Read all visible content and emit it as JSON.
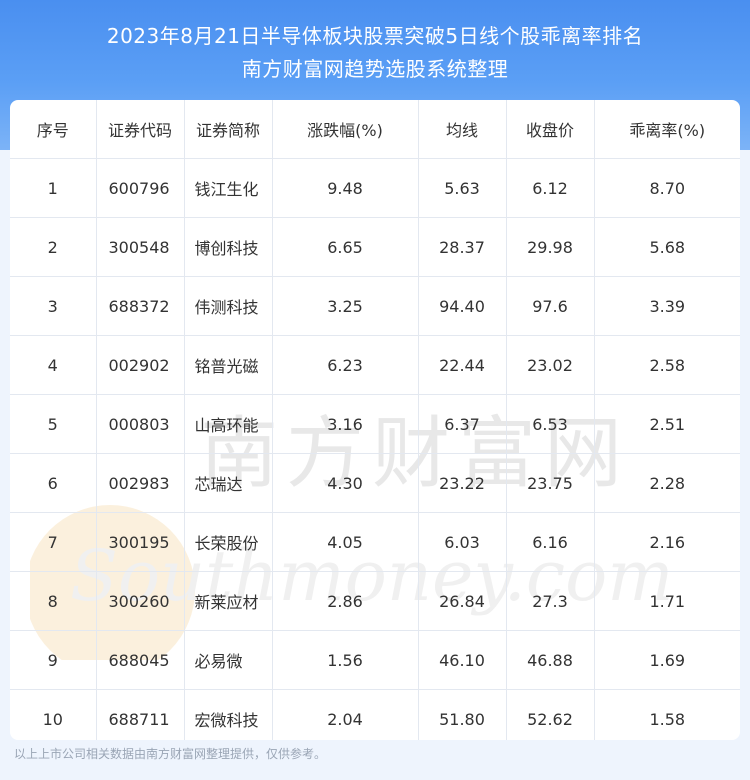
{
  "title": {
    "line1": "2023年8月21日半导体板块股票突破5日线个股乖离率排名",
    "line2": "南方财富网趋势选股系统整理"
  },
  "table": {
    "headers": [
      "序号",
      "证券代码",
      "证券简称",
      "涨跌幅(%)",
      "均线",
      "收盘价",
      "乖离率(%)"
    ],
    "rows": [
      [
        "1",
        "600796",
        "钱江生化",
        "9.48",
        "5.63",
        "6.12",
        "8.70"
      ],
      [
        "2",
        "300548",
        "博创科技",
        "6.65",
        "28.37",
        "29.98",
        "5.68"
      ],
      [
        "3",
        "688372",
        "伟测科技",
        "3.25",
        "94.40",
        "97.6",
        "3.39"
      ],
      [
        "4",
        "002902",
        "铭普光磁",
        "6.23",
        "22.44",
        "23.02",
        "2.58"
      ],
      [
        "5",
        "000803",
        "山高环能",
        "3.16",
        "6.37",
        "6.53",
        "2.51"
      ],
      [
        "6",
        "002983",
        "芯瑞达",
        "4.30",
        "23.22",
        "23.75",
        "2.28"
      ],
      [
        "7",
        "300195",
        "长荣股份",
        "4.05",
        "6.03",
        "6.16",
        "2.16"
      ],
      [
        "8",
        "300260",
        "新莱应材",
        "2.86",
        "26.84",
        "27.3",
        "1.71"
      ],
      [
        "9",
        "688045",
        "必易微",
        "1.56",
        "46.10",
        "46.88",
        "1.69"
      ],
      [
        "10",
        "688711",
        "宏微科技",
        "2.04",
        "51.80",
        "52.62",
        "1.58"
      ]
    ]
  },
  "watermark": {
    "cn": "南方财富网",
    "en": "Southmoney.com"
  },
  "footer": "以上上市公司相关数据由南方财富网整理提供，仅供参考。"
}
